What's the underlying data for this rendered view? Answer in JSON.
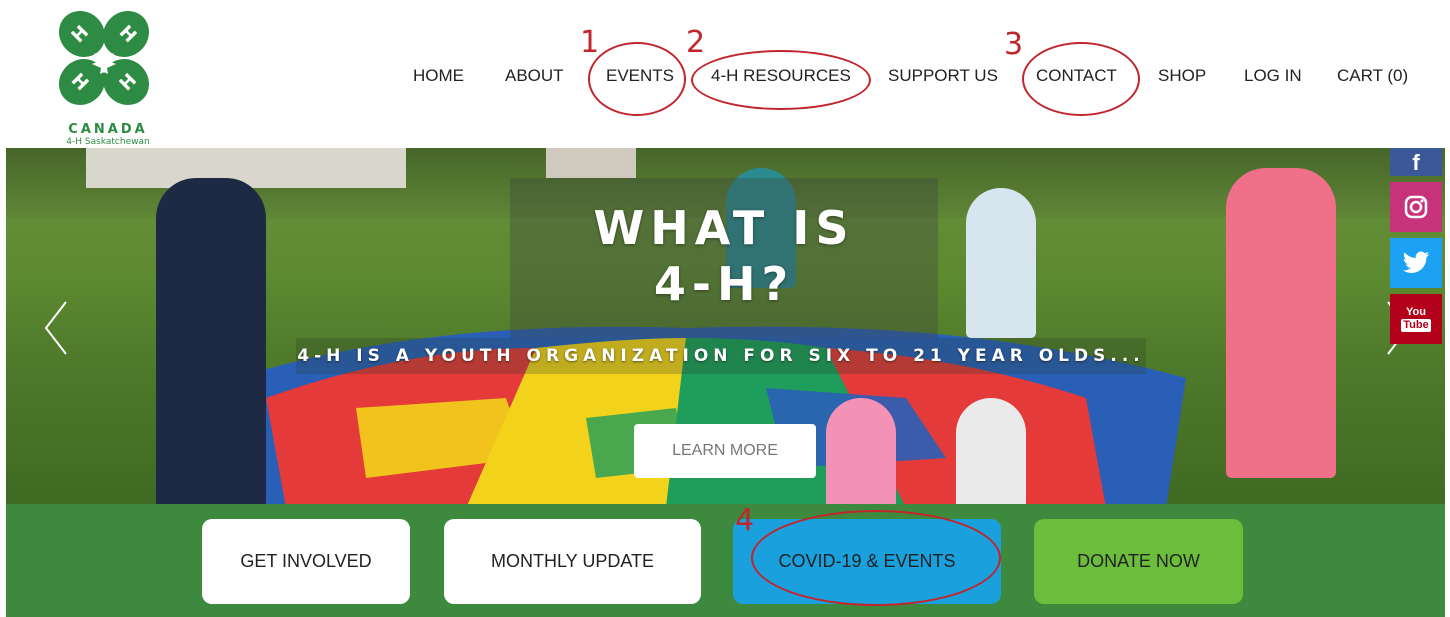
{
  "logo": {
    "word": "CANADA",
    "sub": "4-H Saskatchewan",
    "letter": "H",
    "color": "#2e8b43"
  },
  "nav": {
    "home": "HOME",
    "about": "ABOUT",
    "events": "EVENTS",
    "resources": "4-H RESOURCES",
    "support": "SUPPORT US",
    "contact": "CONTACT",
    "shop": "SHOP",
    "login": "LOG IN",
    "cart": "CART (0)"
  },
  "hero": {
    "title_line1": "WHAT IS",
    "title_line2": "4-H?",
    "tagline": "4-H IS A YOUTH ORGANIZATION FOR SIX TO 21 YEAR OLDS...",
    "button": "LEARN MORE"
  },
  "social": {
    "facebook": "f",
    "instagram": "instagram-icon",
    "twitter": "twitter-icon",
    "youtube_top": "You",
    "youtube_bottom": "Tube"
  },
  "cta": {
    "get_involved": "GET INVOLVED",
    "monthly_update": "MONTHLY UPDATE",
    "covid": "COVID-19 & EVENTS",
    "donate": "DONATE NOW"
  },
  "annotations": {
    "n1": "1",
    "n2": "2",
    "n3": "3",
    "n4": "4"
  },
  "colors": {
    "green_band": "#3d8a3f",
    "covid_blue": "#1aa0dc",
    "donate_green": "#6cbd3c",
    "annotation_red": "#c0262c",
    "instagram": "#c8327a",
    "twitter": "#1da1f2",
    "youtube": "#b3001b",
    "facebook": "#3b5998"
  }
}
